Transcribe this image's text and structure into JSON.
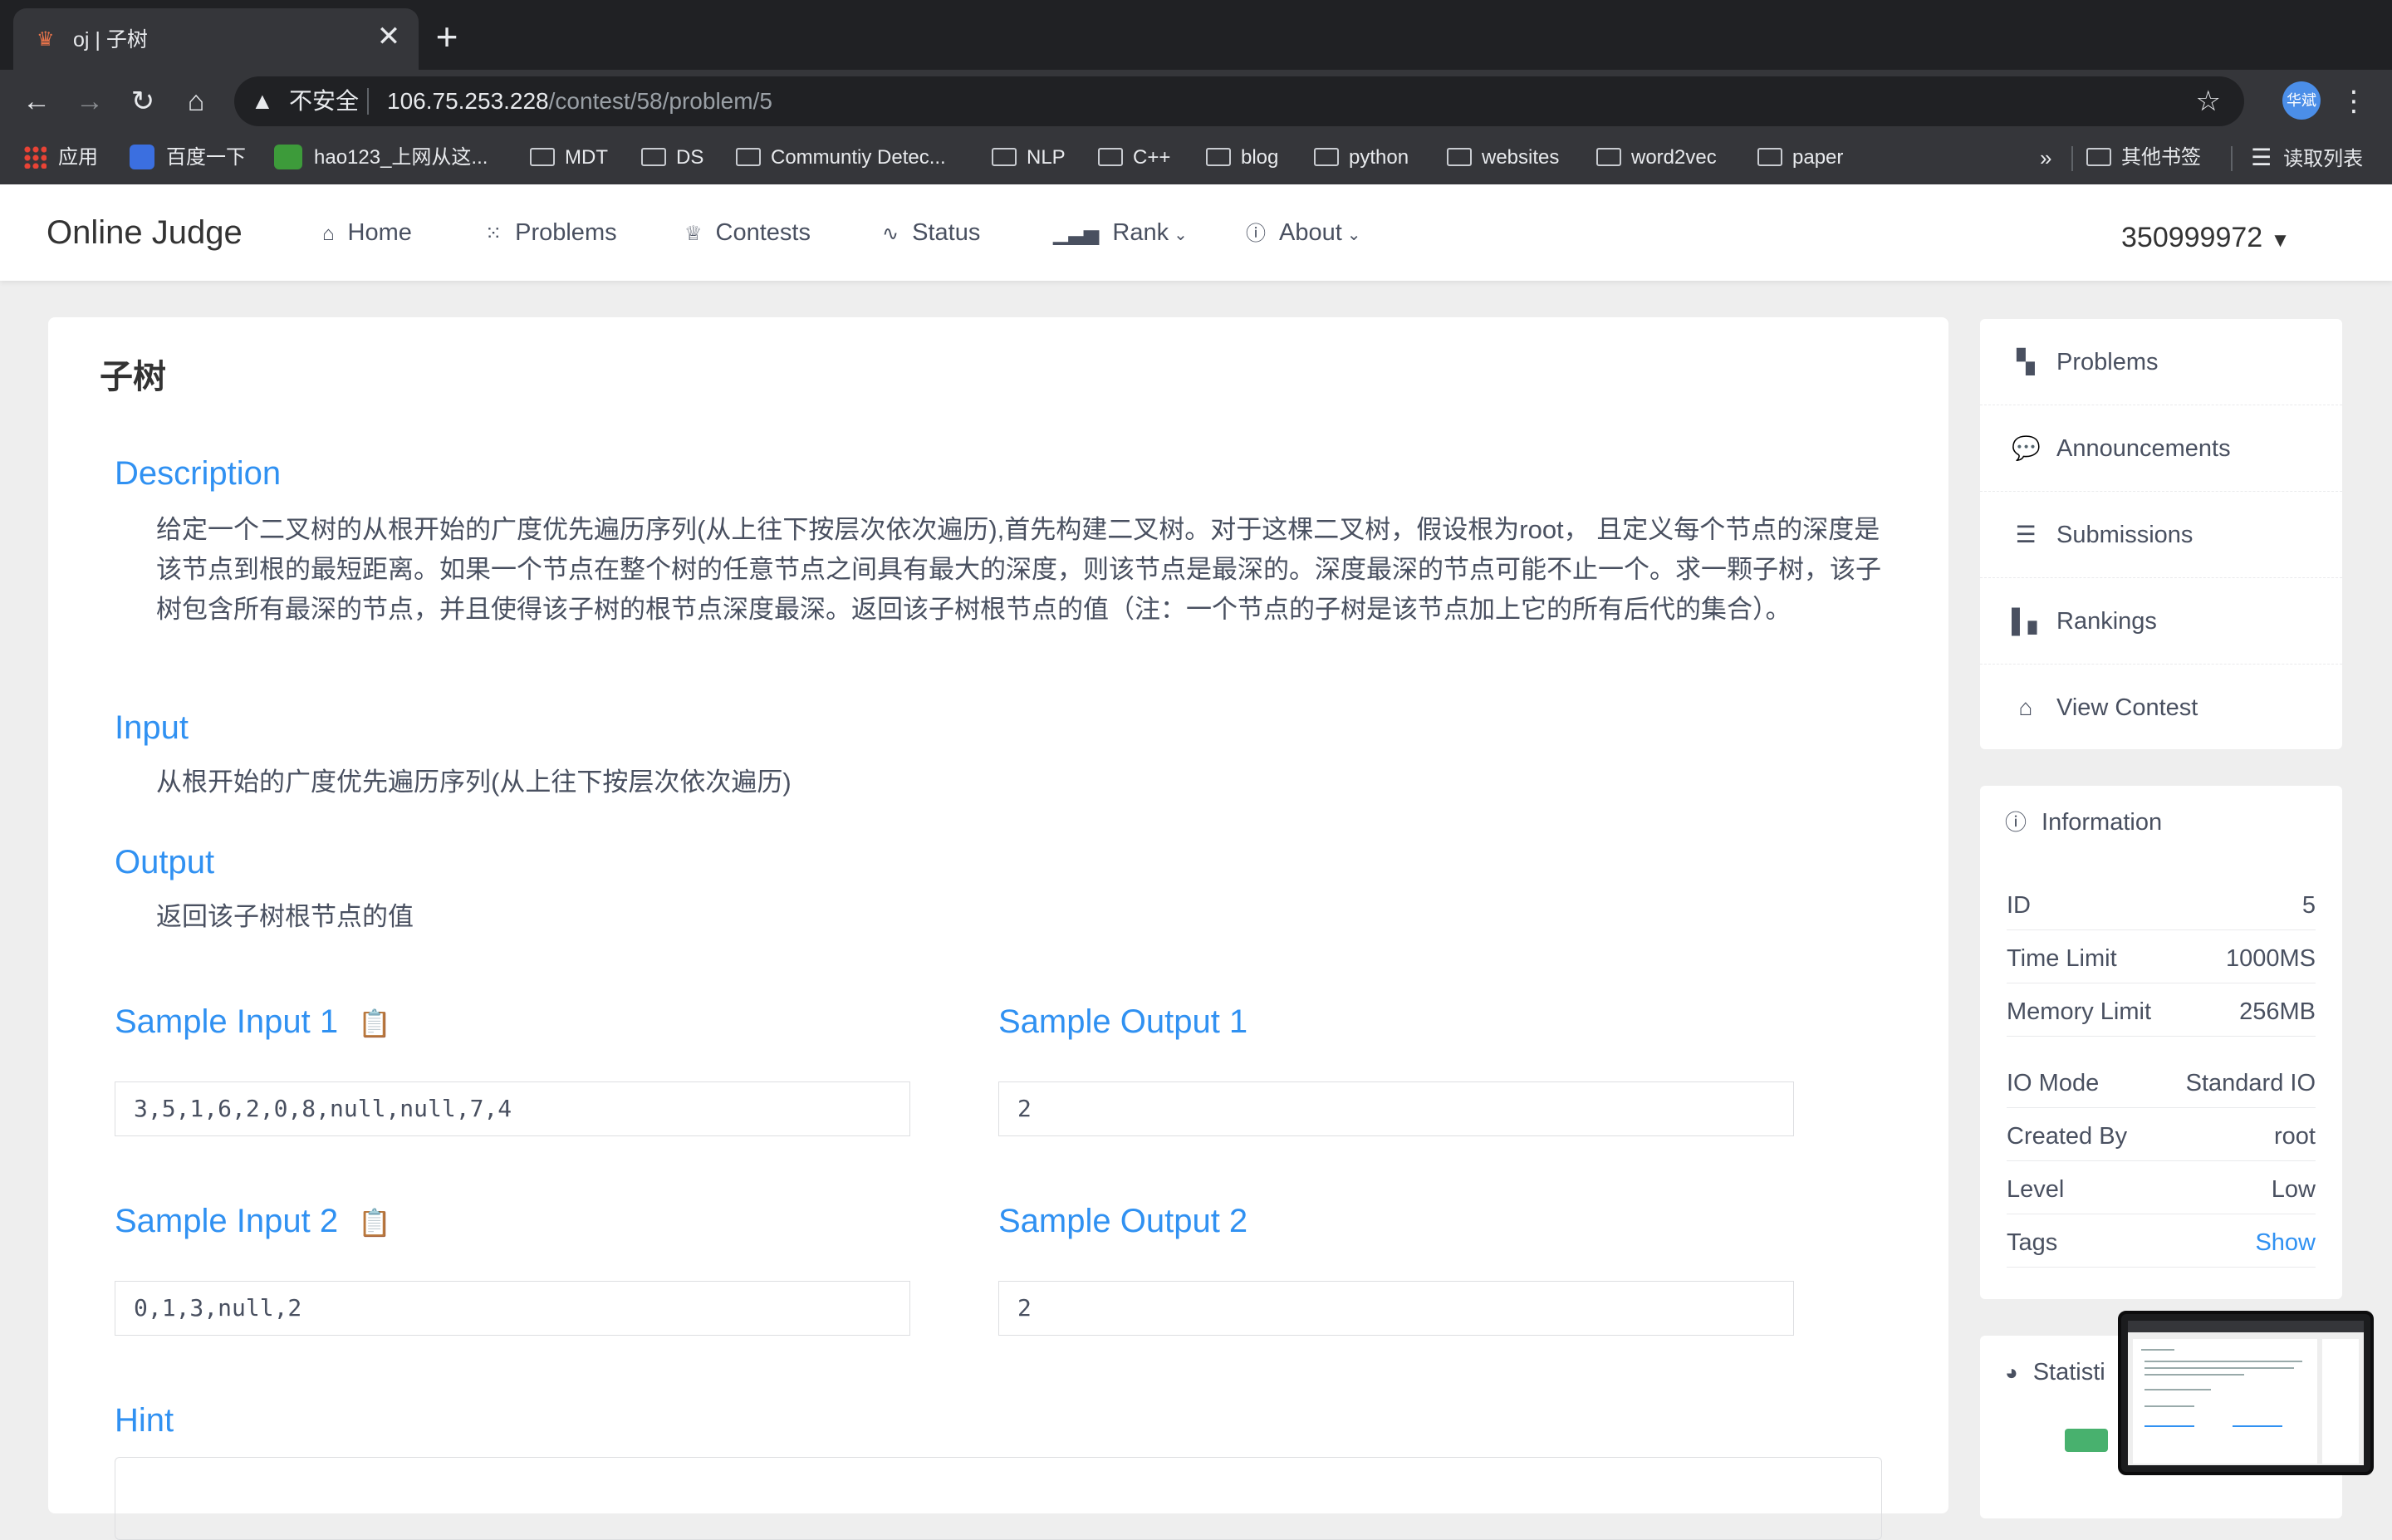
{
  "browser": {
    "tab_title": "oj | 子树",
    "tab_close": "✕",
    "new_tab": "+",
    "insecure_label": "不安全",
    "url_host": "106.75.253.228",
    "url_path": "/contest/58/problem/5",
    "profile_label": "华斌"
  },
  "bookmarks": {
    "items": [
      "应用",
      "百度一下",
      "hao123_上网从这...",
      "MDT",
      "DS",
      "Communtiy Detec...",
      "NLP",
      "C++",
      "blog",
      "python",
      "websites",
      "word2vec",
      "paper"
    ],
    "overflow": "»",
    "other_bookmarks": "其他书签",
    "reading_list": "读取列表"
  },
  "site": {
    "brand": "Online Judge",
    "nav": [
      "Home",
      "Problems",
      "Contests",
      "Status",
      "Rank",
      "About"
    ],
    "user": "350999972"
  },
  "problem": {
    "title": "子树",
    "description_title": "Description",
    "description": "给定一个二叉树的从根开始的广度优先遍历序列(从上往下按层次依次遍历),首先构建二叉树。对于这棵二叉树，假设根为root， 且定义每个节点的深度是该节点到根的最短距离。如果一个节点在整个树的任意节点之间具有最大的深度，则该节点是最深的。深度最深的节点可能不止一个。求一颗子树，该子树包含所有最深的节点，并且使得该子树的根节点深度最深。返回该子树根节点的值（注：一个节点的子树是该节点加上它的所有后代的集合）。",
    "input_title": "Input",
    "input": "从根开始的广度优先遍历序列(从上往下按层次依次遍历)",
    "output_title": "Output",
    "output": "返回该子树根节点的值",
    "samples": [
      {
        "input_title": "Sample Input 1",
        "input": "3,5,1,6,2,0,8,null,null,7,4",
        "output_title": "Sample Output 1",
        "output": "2"
      },
      {
        "input_title": "Sample Input 2",
        "input": "0,1,3,null,2",
        "output_title": "Sample Output 2",
        "output": "2"
      }
    ],
    "hint_title": "Hint"
  },
  "sidebar": {
    "menu": [
      "Problems",
      "Announcements",
      "Submissions",
      "Rankings",
      "View Contest"
    ],
    "info_title": "Information",
    "info": [
      {
        "key": "ID",
        "value": "5"
      },
      {
        "key": "Time Limit",
        "value": "1000MS"
      },
      {
        "key": "Memory Limit",
        "value": "256MB"
      },
      {
        "key": "IO Mode",
        "value": "Standard IO"
      },
      {
        "key": "Created By",
        "value": "root"
      },
      {
        "key": "Level",
        "value": "Low"
      },
      {
        "key": "Tags",
        "value": "Show"
      }
    ],
    "stats_title": "Statisti"
  },
  "colors": {
    "accent": "#3091f2",
    "browser_dark": "#202124",
    "browser_mid": "#35363a",
    "stats_green": "#48b16e"
  },
  "icons": {
    "home": "home-icon",
    "problems": "grid-icon",
    "contests": "trophy-icon",
    "status": "pulse-icon",
    "rank": "bar-chart-icon",
    "about": "info-icon",
    "clipboard": "clipboard-icon"
  }
}
